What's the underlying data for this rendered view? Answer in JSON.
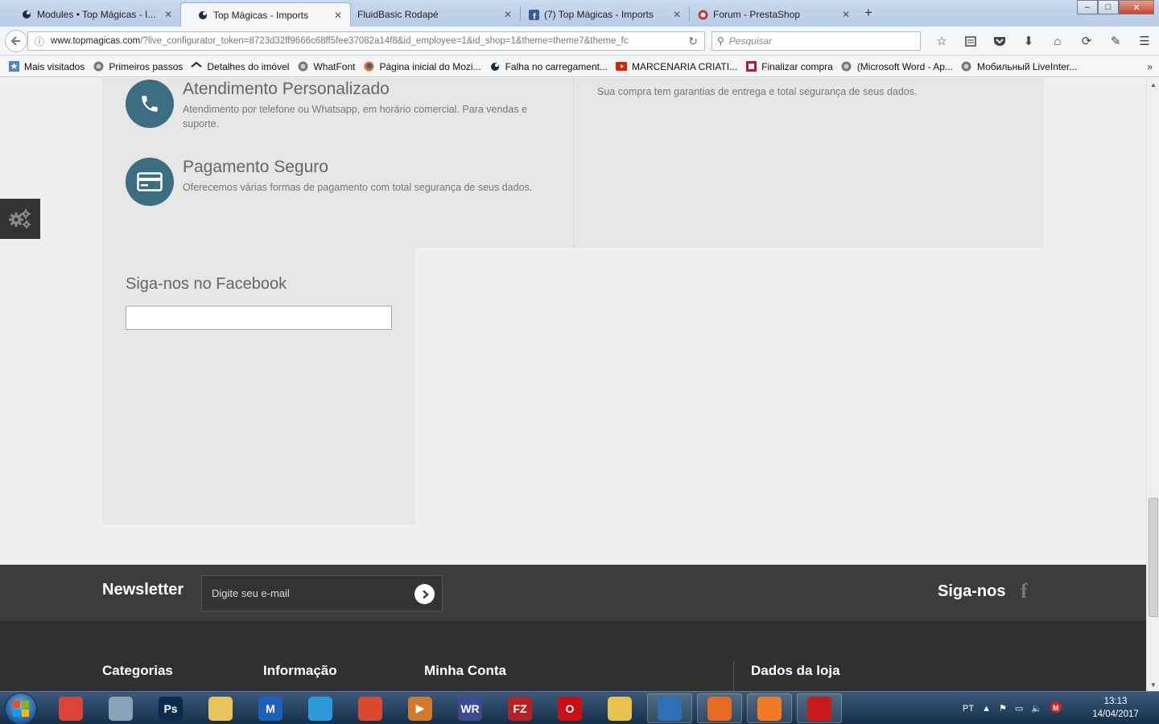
{
  "browser": {
    "tabs": [
      {
        "title": "Modules • Top Mágicas - I...",
        "active": false
      },
      {
        "title": "Top Mágicas - Imports",
        "active": true
      },
      {
        "title": "FluidBasic Rodapé",
        "active": false
      },
      {
        "title": "(7) Top Mágicas - Imports",
        "active": false
      },
      {
        "title": "Forum - PrestaShop",
        "active": false
      }
    ],
    "newtab_label": "+",
    "url_host": "www.topmagicas.com",
    "url_path": "/?live_configurator_token=8723d32ff9666c68ff5fee37082a14f8&id_employee=1&id_shop=1&theme=theme7&theme_fc",
    "search_placeholder": "Pesquisar",
    "window_controls": {
      "minimize": "–",
      "maximize": "□",
      "close": "✕"
    }
  },
  "bookmarks": [
    {
      "label": "Mais visitados",
      "icon": "star-icon"
    },
    {
      "label": "Primeiros passos",
      "icon": "globe-icon"
    },
    {
      "label": "Detalhes do imóvel",
      "icon": "house-icon"
    },
    {
      "label": "WhatFont",
      "icon": "globe-icon"
    },
    {
      "label": "Página inicial do Mozi...",
      "icon": "firefox-icon"
    },
    {
      "label": "Falha no carregament...",
      "icon": "prestashop-icon"
    },
    {
      "label": "MARCENARIA CRIATI...",
      "icon": "youtube-icon"
    },
    {
      "label": "Finalizar compra",
      "icon": "store-icon"
    },
    {
      "label": "(Microsoft Word - Ap...",
      "icon": "globe-icon"
    },
    {
      "label": "Мобильный LiveInter...",
      "icon": "globe-icon"
    }
  ],
  "bookmarks_more": "»",
  "features": [
    {
      "title": "Atendimento Personalizado",
      "description": "Atendimento por telefone ou Whatsapp, em horário comercial. Para vendas e suporte.",
      "icon": "phone-icon"
    },
    {
      "title": "Pagamento Seguro",
      "description": "Oferecemos várias formas de pagamento com total segurança de seus dados.",
      "icon": "credit-card-icon"
    }
  ],
  "right_panel_text": "Sua compra tem garantias de entrega e total segurança de seus dados.",
  "facebook_block": {
    "title": "Siga-nos no Facebook"
  },
  "newsletter": {
    "title": "Newsletter",
    "placeholder": "Digite seu e-mail"
  },
  "follow_us": {
    "label": "Siga-nos",
    "icon": "f"
  },
  "footer_columns": [
    "Categorias",
    "Informação",
    "Minha Conta",
    "Dados da loja"
  ],
  "taskbar": {
    "apps": [
      {
        "name": "chrome",
        "glyph": "",
        "color": "#db4437",
        "running": false
      },
      {
        "name": "calculator",
        "glyph": "",
        "color": "#8aa3b8",
        "running": false
      },
      {
        "name": "photoshop",
        "glyph": "Ps",
        "color": "#0a2b4d",
        "running": false
      },
      {
        "name": "explorer",
        "glyph": "",
        "color": "#e8c45a",
        "running": false
      },
      {
        "name": "malwarebytes",
        "glyph": "M",
        "color": "#1d5fbf",
        "running": false
      },
      {
        "name": "sync",
        "glyph": "",
        "color": "#2c9ad8",
        "running": false
      },
      {
        "name": "ccleaner",
        "glyph": "",
        "color": "#d9492b",
        "running": false
      },
      {
        "name": "media",
        "glyph": "▶",
        "color": "#d2792b",
        "running": false
      },
      {
        "name": "winrar",
        "glyph": "WR",
        "color": "#3b4a8f",
        "running": false
      },
      {
        "name": "filezilla",
        "glyph": "FZ",
        "color": "#b52222",
        "running": false
      },
      {
        "name": "opera",
        "glyph": "O",
        "color": "#cc0f16",
        "running": false
      },
      {
        "name": "mail",
        "glyph": "",
        "color": "#e9c24d",
        "running": false
      },
      {
        "name": "thunderbird",
        "glyph": "",
        "color": "#2f6fb3",
        "running": true
      },
      {
        "name": "firefox",
        "glyph": "",
        "color": "#e66a1f",
        "running": true
      },
      {
        "name": "origin",
        "glyph": "",
        "color": "#f07b25",
        "running": true
      },
      {
        "name": "gamebooster",
        "glyph": "",
        "color": "#c91a1a",
        "running": true
      }
    ],
    "language": "PT",
    "time": "13:13",
    "date": "14/04/2017"
  }
}
